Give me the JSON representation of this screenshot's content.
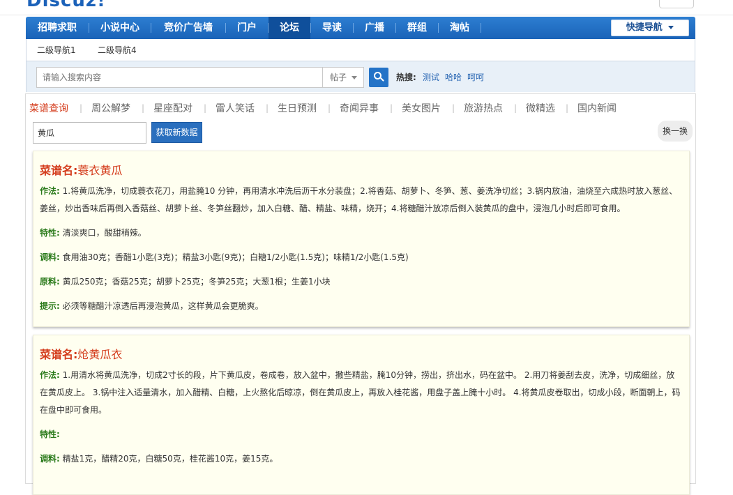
{
  "logo_fragment": "Discuz!",
  "nav": {
    "items": [
      {
        "label": "招聘求职"
      },
      {
        "label": "小说中心"
      },
      {
        "label": "竞价广告墙"
      },
      {
        "label": "门户"
      },
      {
        "label": "论坛"
      },
      {
        "label": "导读"
      },
      {
        "label": "广播"
      },
      {
        "label": "群组"
      },
      {
        "label": "淘帖"
      }
    ],
    "active_index": 4,
    "quick_nav_label": "快捷导航"
  },
  "subnav": {
    "items": [
      {
        "label": "二级导航1"
      },
      {
        "label": "二级导航4"
      }
    ]
  },
  "search": {
    "placeholder": "请输入搜索内容",
    "type_value": "帖子",
    "hot_label": "热搜:",
    "hot_links": [
      "测试",
      "哈哈",
      "呵呵"
    ]
  },
  "tabs": {
    "items": [
      "菜谱查询",
      "周公解梦",
      "星座配对",
      "雷人笑话",
      "生日预测",
      "奇闻异事",
      "美女图片",
      "旅游热点",
      "微精选",
      "国内新闻"
    ],
    "separator": "|",
    "active_index": 0
  },
  "query": {
    "value": "黄瓜",
    "fetch_label": "获取新数据",
    "swap_label": "换一换"
  },
  "recipes": [
    {
      "title_prefix": "菜谱名:",
      "name": "蓑衣黄瓜",
      "method_label": "作法:",
      "method": "1.将黄瓜洗净，切成蓑衣花刀，用盐腌10 分钟，再用清水冲洗后沥干水分装盘；2.将香菇、胡萝卜、冬笋、葱、姜洗净切丝；3.锅内放油，油烧至六成热时放入葱丝、姜丝，炒出香味后再倒入香菇丝、胡萝卜丝、冬笋丝翻炒，加入白糖、醋、精盐、味精，烧开；4.将糖醋汁放凉后倒入装黄瓜的盘中，浸泡几小时后即可食用。",
      "trait_label": "特性:",
      "trait": "清淡爽口，酸甜稍辣。",
      "seasoning_label": "调料:",
      "seasoning": "食用油30克；香醋1小匙(3克)；精盐3小匙(9克)；白糖1/2小匙(1.5克)；味精1/2小匙(1.5克)",
      "ingredients_label": "原料:",
      "ingredients": "黄瓜250克；香菇25克；胡萝卜25克；冬笋25克；大葱1根；生姜1小块",
      "tip_label": "提示:",
      "tip": "必须等糖醋汁凉透后再浸泡黄瓜，这样黄瓜会更脆爽。"
    },
    {
      "title_prefix": "菜谱名:",
      "name": "炝黄瓜衣",
      "method_label": "作法:",
      "method": "1.用清水将黄瓜洗净，切成2寸长的段，片下黄瓜皮，卷成卷，放入盆中，撒些精盐，腌10分钟，捞出，挤出水，码在盆中。 2.用刀将姜刮去皮，洗净，切成细丝，放在黄瓜皮上。 3.锅中注入适量清水，加入醋精、白糖，上火熬化后晾凉，倒在黄瓜皮上，再放入桂花酱，用盘子盖上腌十小时。 4.将黄瓜皮卷取出，切成小段，断面朝上，码在盘中即可食用。",
      "trait_label": "特性:",
      "trait": "",
      "seasoning_label": "调料:",
      "seasoning": "精盐1克，醋精20克，白糖50克，桂花酱10克，姜15克。"
    }
  ]
}
